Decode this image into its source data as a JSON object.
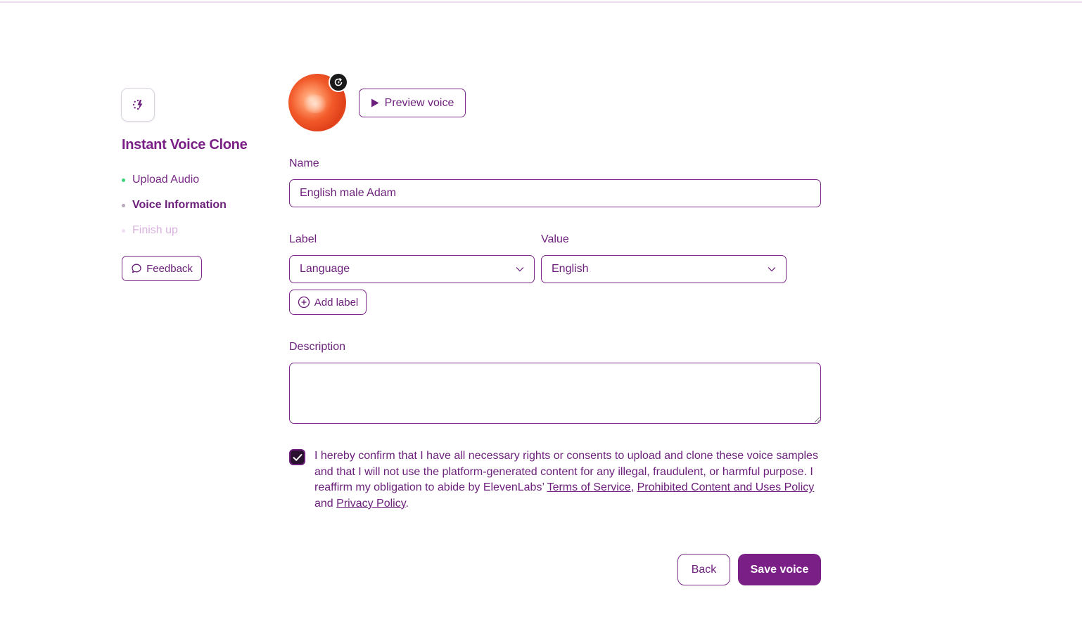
{
  "sidebar": {
    "app_icon": "sparkle-bolt-icon",
    "title": "Instant Voice Clone",
    "steps": [
      {
        "label": "Upload Audio",
        "state": "done"
      },
      {
        "label": "Voice Information",
        "state": "current"
      },
      {
        "label": "Finish up",
        "state": "upcoming"
      }
    ],
    "feedback_label": "Feedback"
  },
  "voice": {
    "avatar_badge_icon": "refresh-icon",
    "preview_label": "Preview voice"
  },
  "form": {
    "name_label": "Name",
    "name_value": "English male Adam",
    "label_header": "Label",
    "value_header": "Value",
    "label_selected": "Language",
    "value_selected": "English",
    "add_label": "Add label",
    "description_label": "Description",
    "description_value": ""
  },
  "consent": {
    "checked": true,
    "text_before": "I hereby confirm that I have all necessary rights or consents to upload and clone these voice samples and that I will not use the platform-generated content for any illegal, fraudulent, or harmful purpose. I reaffirm my obligation to abide by ElevenLabs’ ",
    "terms_link": "Terms of Service",
    "sep1": ", ",
    "prohibited_link": "Prohibited Content and Uses Policy",
    "sep2": " and ",
    "privacy_link": "Privacy Policy",
    "end": "."
  },
  "actions": {
    "back_label": "Back",
    "save_label": "Save voice"
  },
  "colors": {
    "brand": "#7a1f85",
    "text": "#6b1f7a",
    "step_done_dot": "#3ccf7a"
  }
}
